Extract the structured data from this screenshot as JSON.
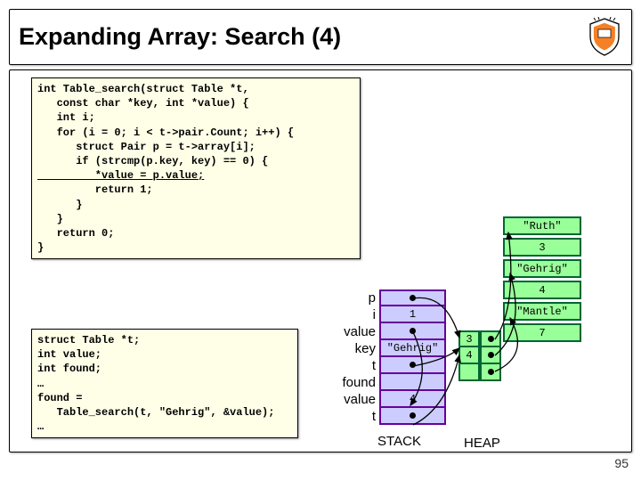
{
  "title": "Expanding Array: Search (4)",
  "code1": "int Table_search(struct Table *t,\n   const char *key, int *value) {\n   int i;\n   for (i = 0; i < t->pair.Count; i++) {\n      struct Pair p = t->array[i];\n      if (strcmp(p.key, key) == 0) {",
  "code1_hl": "         *value = p.value;",
  "code1_after": "         return 1;\n      }\n   }\n   return 0;\n}",
  "code2": "struct Table *t;\nint value;\nint found;\n…\nfound =\n   Table_search(t, \"Gehrig\", &value);\n…",
  "stack": {
    "rows": [
      {
        "label": "p",
        "value": "•"
      },
      {
        "label": "i",
        "value": "1"
      },
      {
        "label": "value",
        "value": "•"
      },
      {
        "label": "key",
        "value": "\"Gehrig\""
      },
      {
        "label": "t",
        "value": "•"
      },
      {
        "label": "found",
        "value": ""
      },
      {
        "label": "value",
        "value": "4"
      },
      {
        "label": "t",
        "value": "•"
      }
    ],
    "caption": "STACK"
  },
  "heap": {
    "cells": [
      "\"Ruth\"",
      "3",
      "\"Gehrig\"",
      "4",
      "\"Mantle\"",
      "7"
    ],
    "table": [
      [
        "3",
        "•"
      ],
      [
        "4",
        "•"
      ],
      [
        "",
        "•"
      ]
    ],
    "caption": "HEAP"
  },
  "pageNum": "95"
}
